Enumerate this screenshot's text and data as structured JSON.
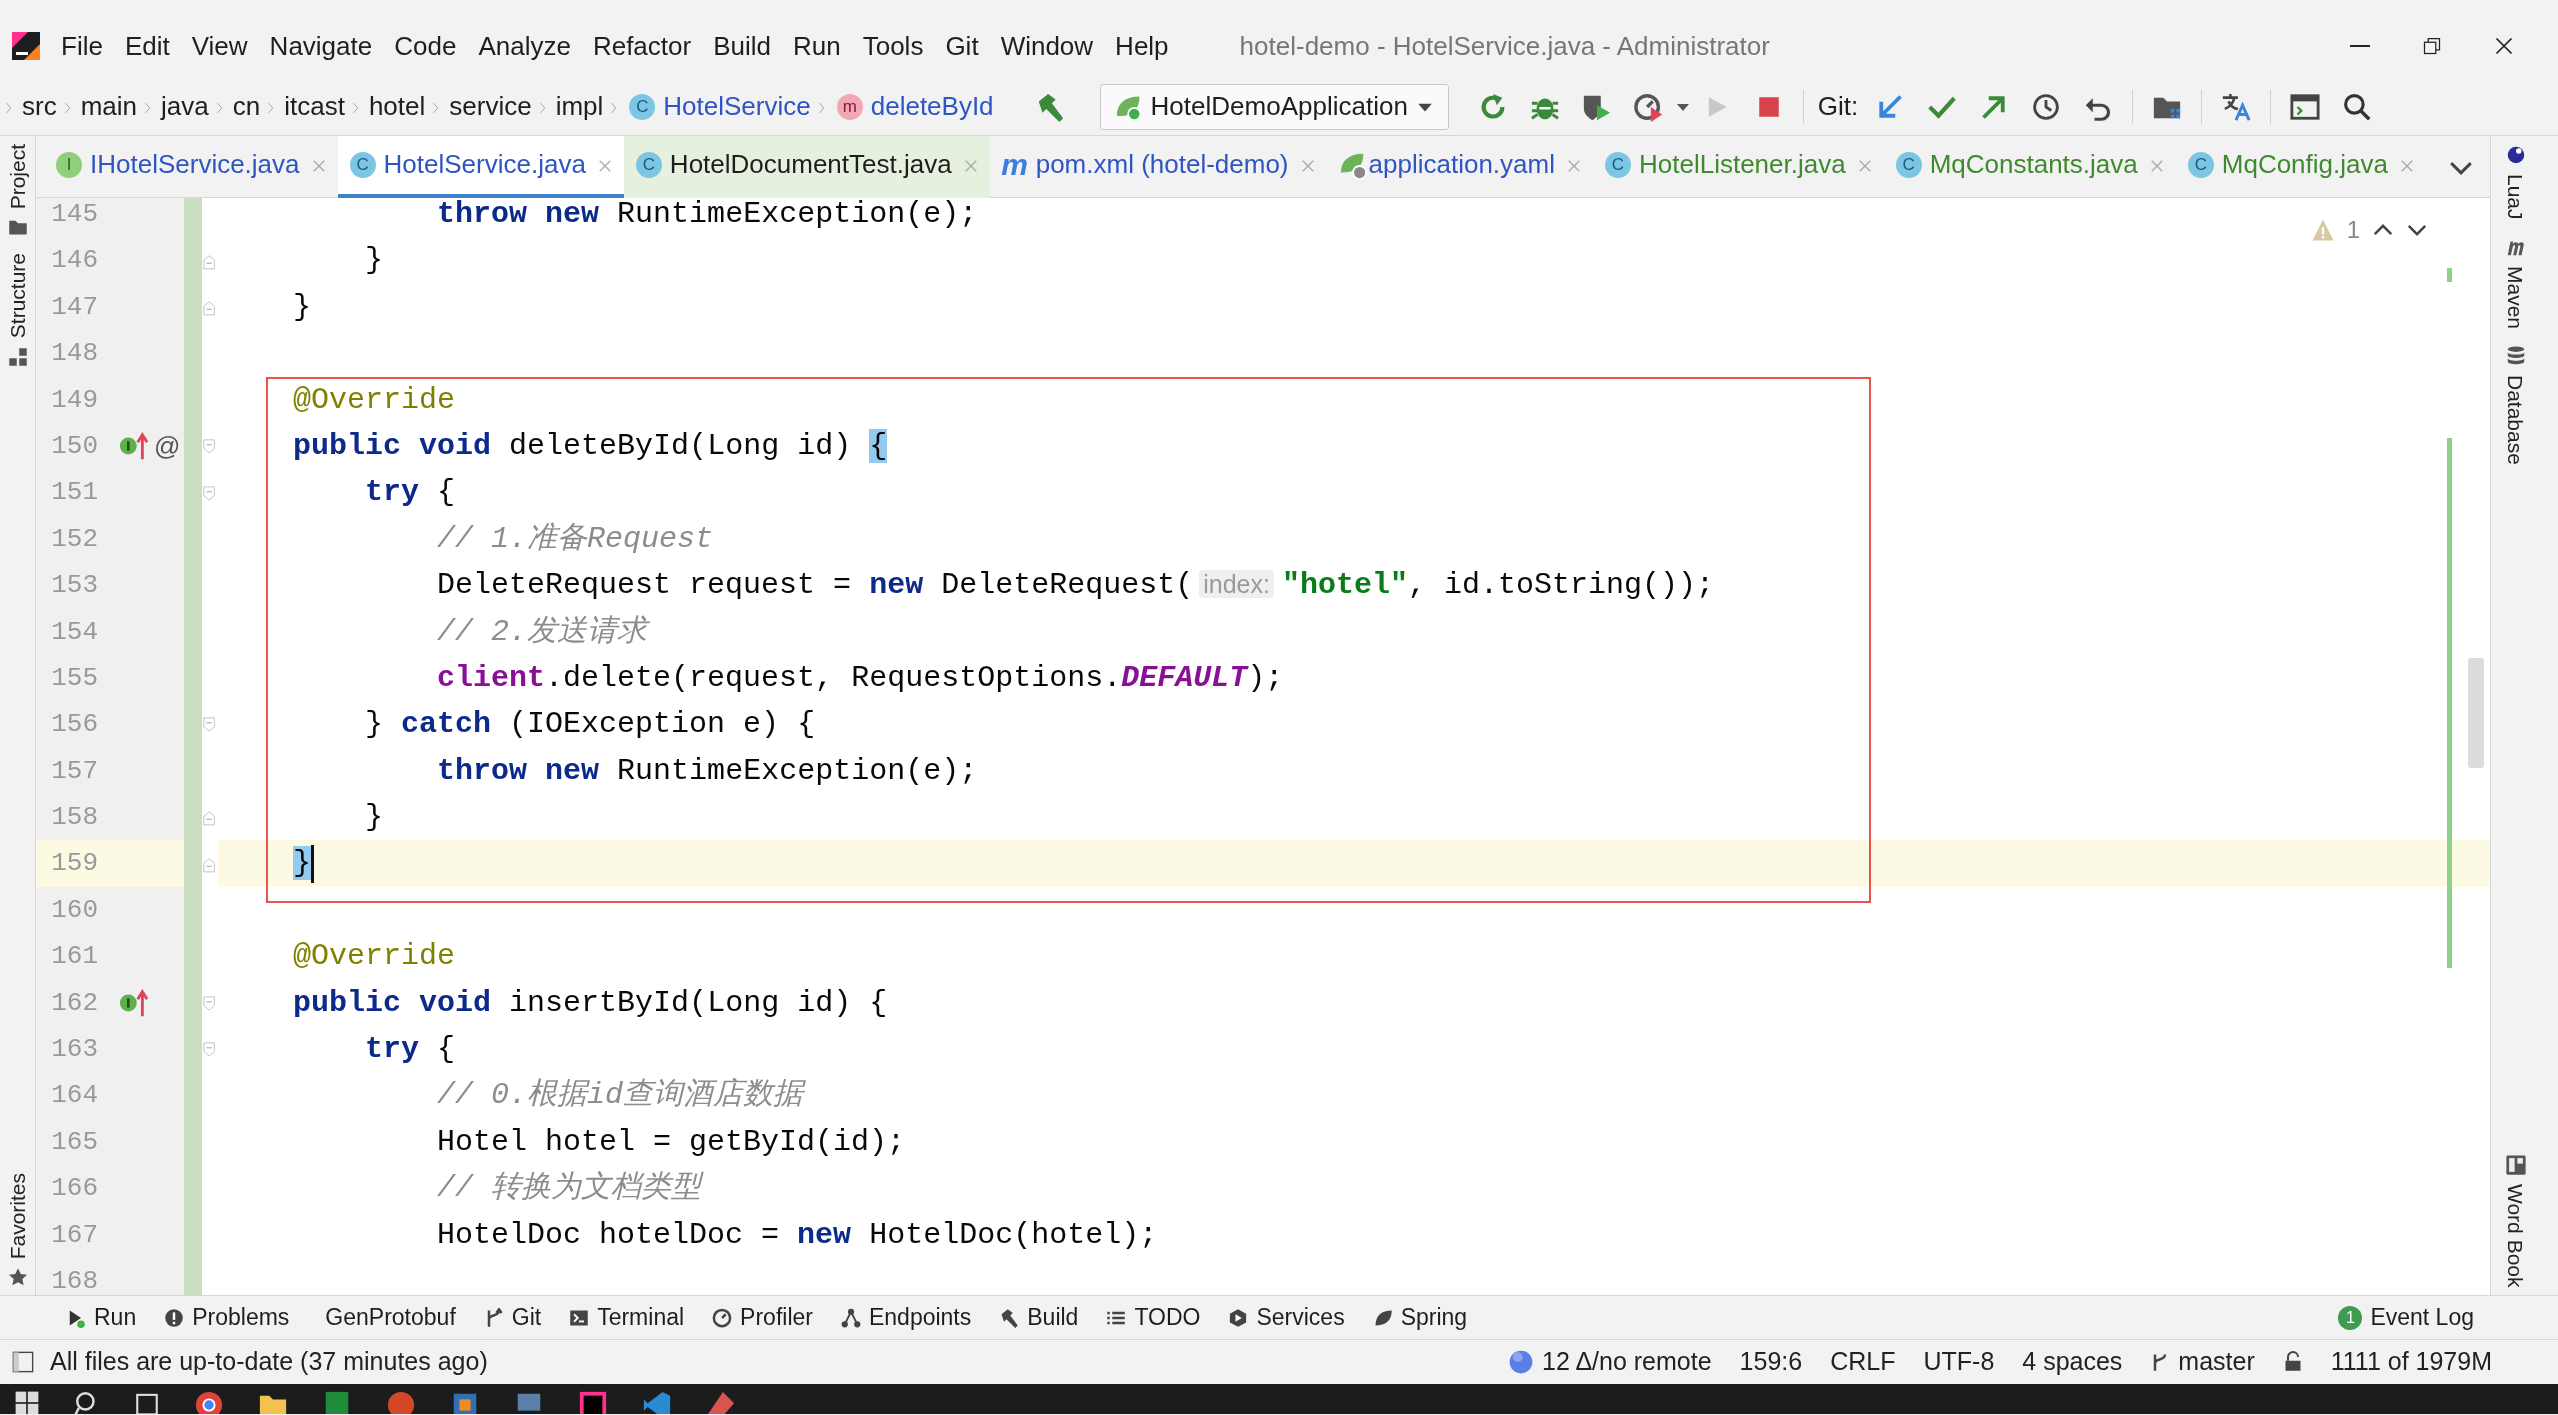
{
  "window": {
    "title": "hotel-demo - HotelService.java - Administrator"
  },
  "menu": [
    "File",
    "Edit",
    "View",
    "Navigate",
    "Code",
    "Analyze",
    "Refactor",
    "Build",
    "Run",
    "Tools",
    "Git",
    "Window",
    "Help"
  ],
  "breadcrumbs": [
    {
      "label": "src",
      "kind": "folder"
    },
    {
      "label": "main",
      "kind": "folder"
    },
    {
      "label": "java",
      "kind": "folder"
    },
    {
      "label": "cn",
      "kind": "folder"
    },
    {
      "label": "itcast",
      "kind": "folder"
    },
    {
      "label": "hotel",
      "kind": "folder"
    },
    {
      "label": "service",
      "kind": "folder"
    },
    {
      "label": "impl",
      "kind": "folder"
    },
    {
      "label": "HotelService",
      "kind": "class",
      "letter": "C"
    },
    {
      "label": "deleteById",
      "kind": "method",
      "letter": "m"
    }
  ],
  "toolbar": {
    "run_config": "HotelDemoApplication",
    "run_disabled": true,
    "git_label": "Git:"
  },
  "left_tools": [
    {
      "label": "Project",
      "kind": "folder"
    },
    {
      "label": "Structure",
      "kind": "structure"
    }
  ],
  "left_bottom_tools": [
    {
      "label": "Favorites",
      "kind": "star"
    }
  ],
  "right_tools": [
    {
      "label": "LuaJ",
      "kind": "planet"
    },
    {
      "label": "Maven",
      "kind": "maven"
    },
    {
      "label": "Database",
      "kind": "database"
    }
  ],
  "right_bottom_tools": [
    {
      "label": "Word Book",
      "kind": "book"
    }
  ],
  "tabs": [
    {
      "label": "IHotelService.java",
      "kind": "interface",
      "letter": "I",
      "color": "#2f55c2",
      "selected": false
    },
    {
      "label": "HotelService.java",
      "kind": "class",
      "letter": "C",
      "color": "#2f55c2",
      "selected": true
    },
    {
      "label": "HotelDocumentTest.java",
      "kind": "test",
      "letter": "C",
      "color": "#1e1e1e",
      "selected": false
    },
    {
      "label": "pom.xml (hotel-demo)",
      "kind": "maven",
      "letter": "m",
      "color": "#2f55c2",
      "selected": false
    },
    {
      "label": "application.yaml",
      "kind": "yaml",
      "color": "#2f55c2",
      "selected": false
    },
    {
      "label": "HotelListener.java",
      "kind": "class",
      "letter": "C",
      "color": "#3f8a2e",
      "selected": false
    },
    {
      "label": "MqConstants.java",
      "kind": "class",
      "letter": "C",
      "color": "#3f8a2e",
      "selected": false
    },
    {
      "label": "MqConfig.java",
      "kind": "class",
      "letter": "C",
      "color": "#3f8a2e",
      "selected": false
    }
  ],
  "inspections": {
    "warnings": "1"
  },
  "blocks": [
    {
      "boxed": false,
      "lines": [
        {
          "number": "145",
          "added": true,
          "current": false,
          "tokens": [
            {
              "text": "            throw",
              "kind": "keyword"
            },
            {
              "text": " new",
              "kind": "keyword"
            },
            {
              "text": " RuntimeException(e);",
              "kind": "plain"
            }
          ]
        },
        {
          "number": "146",
          "added": true,
          "current": false,
          "fold_end": true,
          "tokens": [
            {
              "text": "        }",
              "kind": "plain"
            }
          ]
        },
        {
          "number": "147",
          "added": true,
          "current": false,
          "fold_end": true,
          "tokens": [
            {
              "text": "    }",
              "kind": "plain"
            }
          ]
        },
        {
          "number": "148",
          "added": true,
          "current": false
        }
      ]
    },
    {
      "boxed": true,
      "lines": [
        {
          "number": "149",
          "added": true,
          "current": false,
          "tokens": [
            {
              "text": "    @Override",
              "kind": "annotation"
            }
          ]
        },
        {
          "number": "150",
          "added": true,
          "current": false,
          "fold_start": true,
          "marks": [
            {
              "kind": "implements"
            },
            {
              "kind": "text",
              "text": "@"
            }
          ],
          "tokens": [
            {
              "text": "    public",
              "kind": "keyword"
            },
            {
              "text": " void",
              "kind": "keyword"
            },
            {
              "text": " deleteById(Long id) ",
              "kind": "plain"
            },
            {
              "text": "{",
              "kind": "brace"
            }
          ]
        },
        {
          "number": "151",
          "added": true,
          "current": false,
          "fold_start": true,
          "tokens": [
            {
              "text": "        try",
              "kind": "keyword"
            },
            {
              "text": " {",
              "kind": "plain"
            }
          ]
        },
        {
          "number": "152",
          "added": true,
          "current": false,
          "tokens": [
            {
              "text": "            // 1.准备Request",
              "kind": "comment"
            }
          ]
        },
        {
          "number": "153",
          "added": true,
          "current": false,
          "tokens": [
            {
              "text": "            DeleteRequest request = ",
              "kind": "plain"
            },
            {
              "text": "new",
              "kind": "keyword"
            },
            {
              "text": " DeleteRequest(",
              "kind": "plain"
            },
            {
              "text": "index:",
              "kind": "hint"
            },
            {
              "text": "\"hotel\"",
              "kind": "string"
            },
            {
              "text": ", id.toString());",
              "kind": "plain"
            }
          ]
        },
        {
          "number": "154",
          "added": true,
          "current": false,
          "tokens": [
            {
              "text": "            // 2.发送请求",
              "kind": "comment"
            }
          ]
        },
        {
          "number": "155",
          "added": true,
          "current": false,
          "tokens": [
            {
              "text": "            client",
              "kind": "field"
            },
            {
              "text": ".delete(request, RequestOptions.",
              "kind": "plain"
            },
            {
              "text": "DEFAULT",
              "kind": "constant"
            },
            {
              "text": ");",
              "kind": "plain"
            }
          ]
        },
        {
          "number": "156",
          "added": true,
          "current": false,
          "fold_start": true,
          "tokens": [
            {
              "text": "        } ",
              "kind": "plain"
            },
            {
              "text": "catch",
              "kind": "keyword"
            },
            {
              "text": " (IOException e) {",
              "kind": "plain"
            }
          ]
        },
        {
          "number": "157",
          "added": true,
          "current": false,
          "tokens": [
            {
              "text": "            throw",
              "kind": "keyword"
            },
            {
              "text": " new",
              "kind": "keyword"
            },
            {
              "text": " RuntimeException(e);",
              "kind": "plain"
            }
          ]
        },
        {
          "number": "158",
          "added": true,
          "current": false,
          "fold_end": true,
          "tokens": [
            {
              "text": "        }",
              "kind": "plain"
            }
          ]
        },
        {
          "number": "159",
          "added": true,
          "current": true,
          "fold_end": true,
          "tokens": [
            {
              "text": "    }",
              "kind": "brace"
            }
          ]
        }
      ]
    },
    {
      "boxed": false,
      "lines": [
        {
          "number": "160",
          "added": true,
          "current": false
        },
        {
          "number": "161",
          "added": true,
          "current": false,
          "tokens": [
            {
              "text": "    @Override",
              "kind": "annotation"
            }
          ]
        },
        {
          "number": "162",
          "added": true,
          "current": false,
          "fold_start": true,
          "marks": [
            {
              "kind": "implements"
            }
          ],
          "tokens": [
            {
              "text": "    public",
              "kind": "keyword"
            },
            {
              "text": " void",
              "kind": "keyword"
            },
            {
              "text": " insertById(Long id) {",
              "kind": "plain"
            }
          ]
        },
        {
          "number": "163",
          "added": true,
          "current": false,
          "fold_start": true,
          "tokens": [
            {
              "text": "        try",
              "kind": "keyword"
            },
            {
              "text": " {",
              "kind": "plain"
            }
          ]
        },
        {
          "number": "164",
          "added": true,
          "current": false,
          "tokens": [
            {
              "text": "            // 0.根据id查询酒店数据",
              "kind": "comment"
            }
          ]
        },
        {
          "number": "165",
          "added": true,
          "current": false,
          "tokens": [
            {
              "text": "            Hotel hotel = getById(id);",
              "kind": "plain"
            }
          ]
        },
        {
          "number": "166",
          "added": true,
          "current": false,
          "tokens": [
            {
              "text": "            // 转换为文档类型",
              "kind": "comment"
            }
          ]
        },
        {
          "number": "167",
          "added": true,
          "current": false,
          "tokens": [
            {
              "text": "            HotelDoc hotelDoc = ",
              "kind": "plain"
            },
            {
              "text": "new",
              "kind": "keyword"
            },
            {
              "text": " HotelDoc(hotel);",
              "kind": "plain"
            }
          ]
        },
        {
          "number": "168",
          "added": true,
          "current": false
        }
      ]
    }
  ],
  "tool_windows": [
    {
      "label": "Run",
      "kind": "run"
    },
    {
      "label": "Problems",
      "kind": "problems"
    },
    {
      "label": "GenProtobuf",
      "kind": "none"
    },
    {
      "label": "Git",
      "kind": "git"
    },
    {
      "label": "Terminal",
      "kind": "terminal"
    },
    {
      "label": "Profiler",
      "kind": "profiler"
    },
    {
      "label": "Endpoints",
      "kind": "endpoints"
    },
    {
      "label": "Build",
      "kind": "build"
    },
    {
      "label": "TODO",
      "kind": "todo"
    },
    {
      "label": "Services",
      "kind": "services"
    },
    {
      "label": "Spring",
      "kind": "spring"
    }
  ],
  "event_log": {
    "label": "Event Log",
    "count": "1"
  },
  "status_bar": {
    "message": "All files are up-to-date (37 minutes ago)",
    "vcs": "12 Δ/no remote",
    "position": "159:6",
    "line_separator": "CRLF",
    "encoding": "UTF-8",
    "indent": "4 spaces",
    "branch": "master",
    "memory": "1111 of 1979M"
  }
}
